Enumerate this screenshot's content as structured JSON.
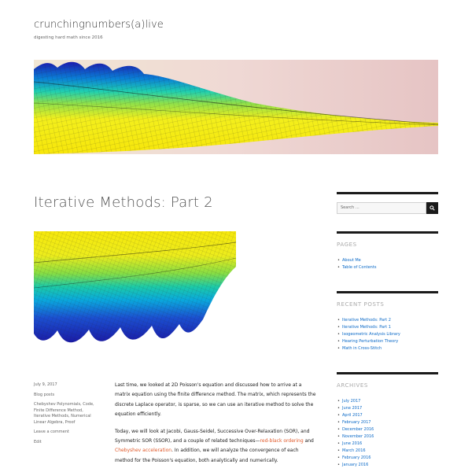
{
  "site": {
    "title": "crunchingnumbers(a)live",
    "tagline": "digesting hard math since 2016"
  },
  "post": {
    "title": "Iterative Methods: Part 2",
    "date": "July 9, 2017",
    "posted_in_label": "Blog posts",
    "tags": [
      "Chebyshev Polynomials",
      "Code",
      "Finite Difference Method",
      "Iterative Methods",
      "Numerical",
      "Linear Algebra",
      "Proof"
    ],
    "tags_display_lines": [
      "Chebyshev Polynomials, Code,",
      "Finite Difference Method,",
      "Iterative Methods, Numerical",
      "Linear Algebra, Proof"
    ],
    "comment_link": "Leave a comment",
    "edit_link": "Edit",
    "paragraphs": [
      {
        "text": "Last time, we looked at 2D Poisson's equation and discussed how to arrive at a matrix equation using the finite difference method. The matrix, which represents the discrete Laplace operator, is sparse, so we can use an iterative method to solve the equation efficiently."
      },
      {
        "before": "Today, we will look at Jacobi, Gauss-Seidel, Successive Over-Relaxation (SOR), and Symmetric SOR (SSOR), and a couple of related techniques—",
        "link1": "red-black ordering",
        "middle": " and ",
        "link2": "Chebyshev acceleration",
        "after": ". In addition, we will analyze the convergence of each method for the Poisson's equation, both analytically and numerically."
      }
    ]
  },
  "sidebar": {
    "search": {
      "placeholder": "Search …",
      "button_icon": "search-icon"
    },
    "pages": {
      "title": "PAGES",
      "items": [
        "About Me",
        "Table of Contents"
      ]
    },
    "recent_posts": {
      "title": "RECENT POSTS",
      "items": [
        "Iterative Methods: Part 2",
        "Iterative Methods: Part 1",
        "Isogeometric Analysis Library",
        "Hearing Perturbation Theory",
        "Math in Cross-Stitch"
      ]
    },
    "archives": {
      "title": "ARCHIVES",
      "items": [
        "July 2017",
        "June 2017",
        "April 2017",
        "February 2017",
        "December 2016",
        "November 2016",
        "June 2016",
        "March 2016",
        "February 2016",
        "January 2016"
      ]
    }
  },
  "colors": {
    "link": "#0a69c7",
    "accent_link": "#e0592a",
    "text": "#1a1a1a",
    "widget_border": "#1a1a1a"
  }
}
